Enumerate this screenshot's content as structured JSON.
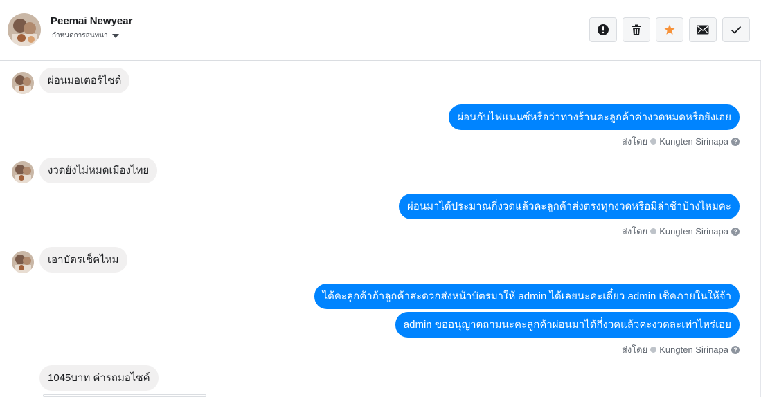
{
  "header": {
    "name": "Peemai Newyear",
    "subtitle": "กำหนดการสนทนา"
  },
  "actions": [
    "alert-icon",
    "trash-icon",
    "star-icon",
    "mail-icon",
    "check-icon"
  ],
  "colors": {
    "outgoing_bubble": "#0084ff",
    "incoming_bubble": "#f1f0f0",
    "star": "#f7923a"
  },
  "messages": {
    "in1": "ผ่อนมอเตอร์ไซด์",
    "out1": "ผ่อนกับไฟแนนซ์หรือว่าทางร้านคะลูกค้าค่างวดหมดหรือยังเอ่ย",
    "in2": "งวดยังไม่หมดเมืองไทย",
    "out2": "ผ่อนมาได้ประมาณกี่งวดแล้วคะลูกค้าส่งตรงทุกงวดหรือมีล่าช้าบ้างไหมคะ",
    "in3": "เอาบัตรเช็คไหม",
    "out3a": "ได้คะลูกค้าถ้าลูกค้าสะดวกส่งหน้าบัตรมาให้ admin ได้เลยนะคะเดี๋ยว admin เช็คภายในให้จ้า",
    "out3b": "admin ขออนุญาตถามนะคะลูกค้าผ่อนมาได้กี่งวดแล้วคะงวดละเท่าไหร่เอ่ย",
    "in4": "1045บาท ค่ารถมอไซค์"
  },
  "sent_by": {
    "label": "ส่งโดย",
    "name": "Kungten Sirinapa"
  }
}
